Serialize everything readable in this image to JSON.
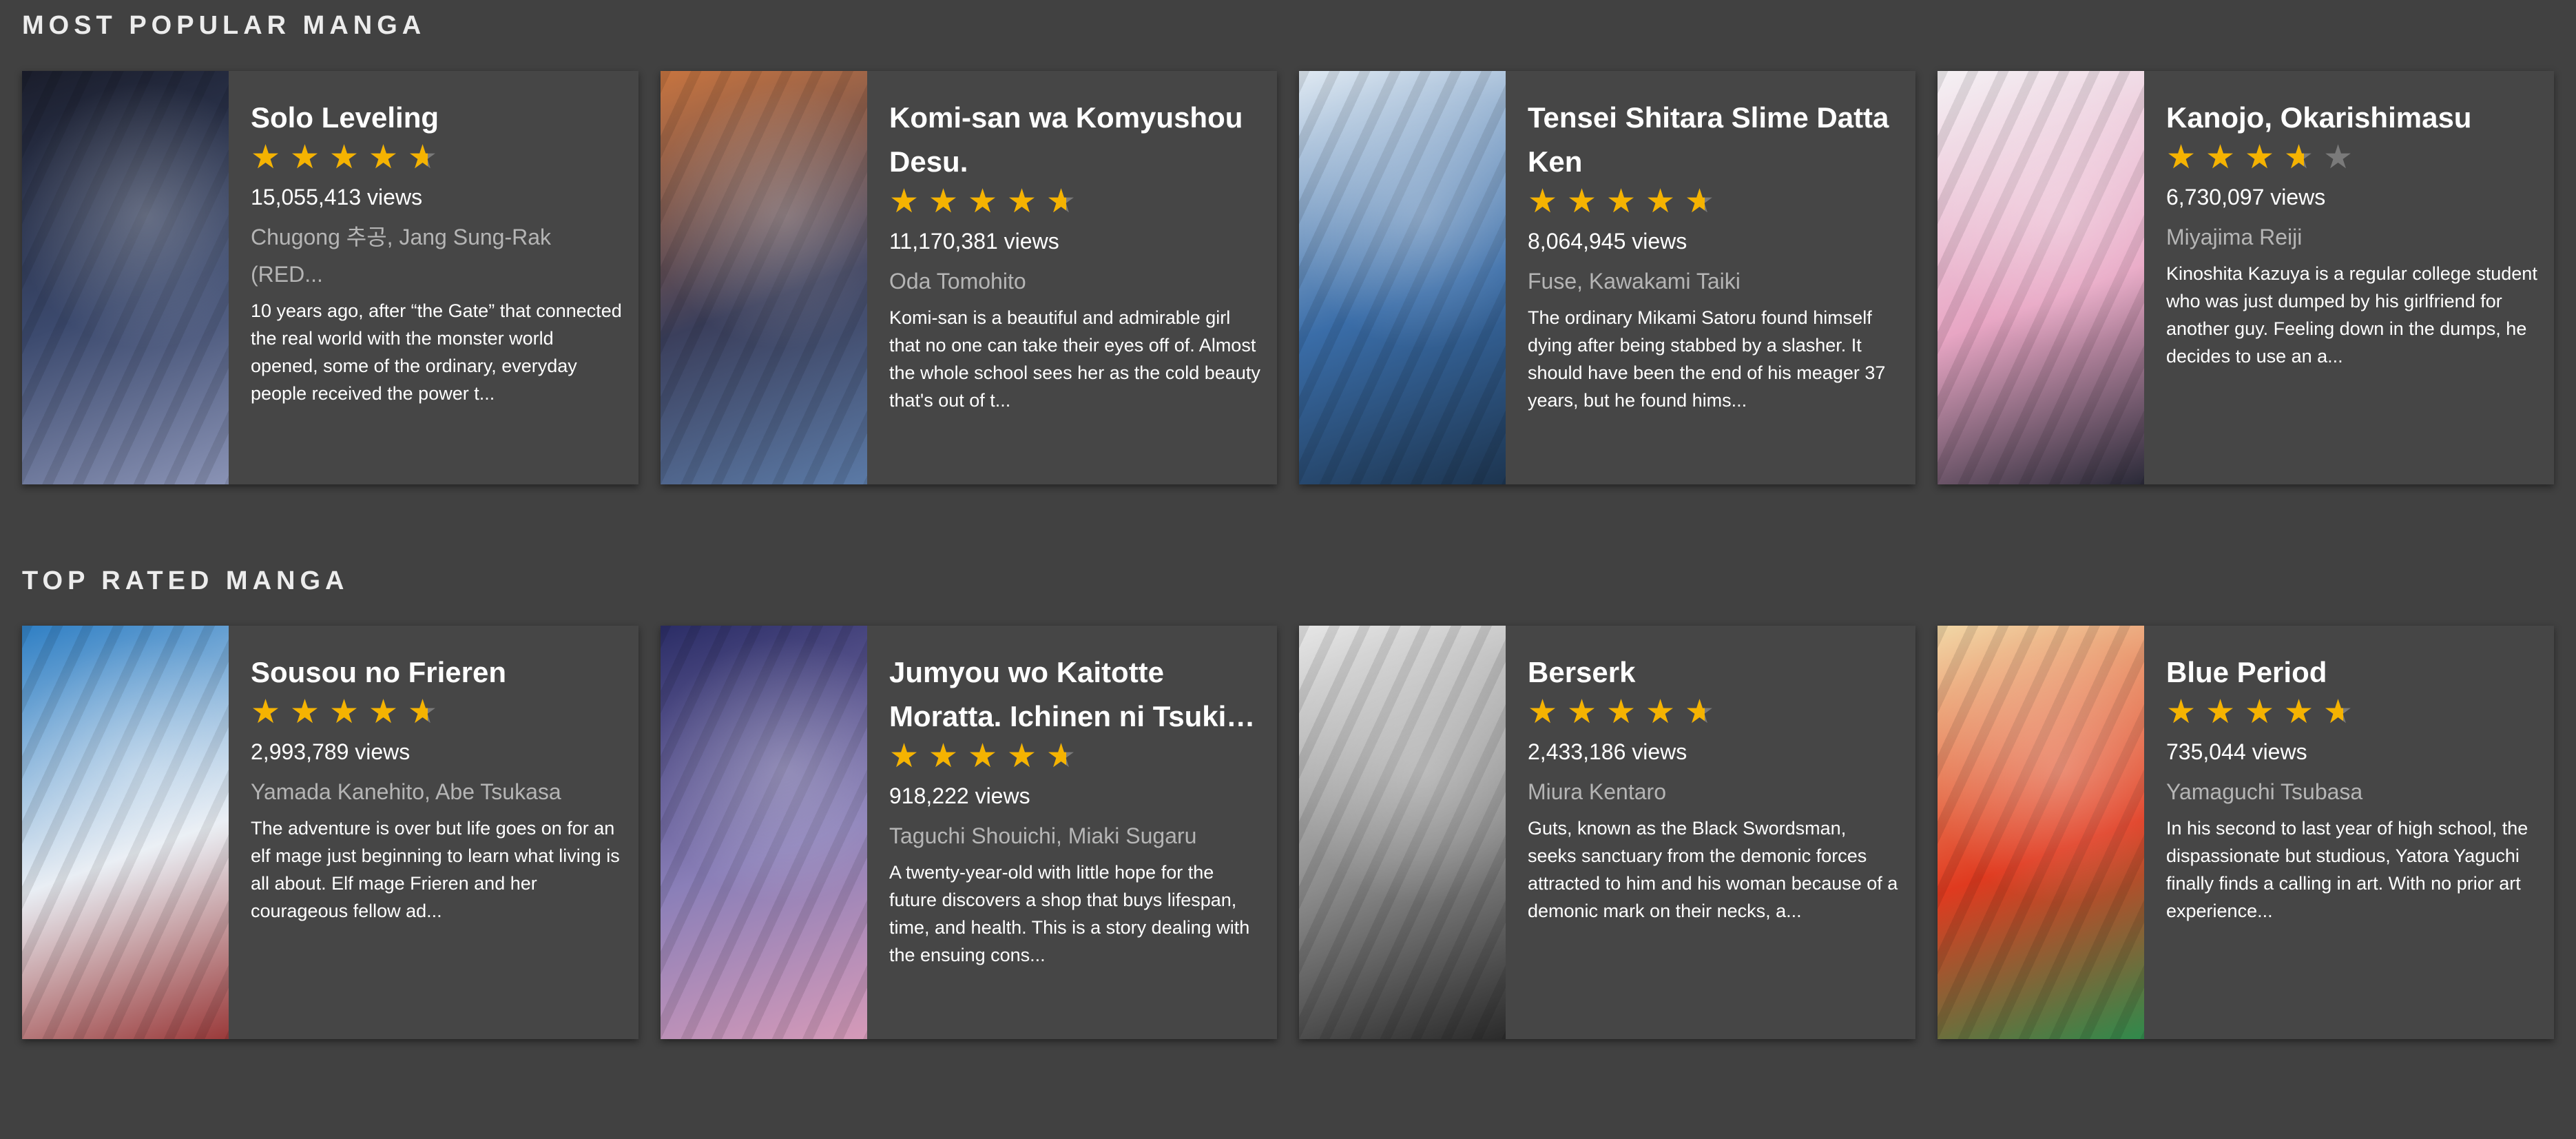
{
  "sections": [
    {
      "title": "MOST POPULAR MANGA",
      "cards": [
        {
          "title": "Solo Leveling",
          "rating": 4.5,
          "views": "15,055,413 views",
          "authors": "Chugong 추공, Jang Sung-Rak (RED...",
          "description": "10 years ago, after “the Gate” that connected the real world with the monster world opened, some of the ordinary, everyday people received the power t...",
          "cover_colors": [
            "#1a1d2b",
            "#3c4a6e",
            "#8a93b5"
          ]
        },
        {
          "title": "Komi-san wa Komyushou Desu.",
          "rating": 4.5,
          "views": "11,170,381 views",
          "authors": "Oda Tomohito",
          "description": "Komi-san is a beautiful and admirable girl that no one can take their eyes off of. Almost the whole school sees her as the cold beauty that's out of t...",
          "cover_colors": [
            "#c7743f",
            "#3b3f5c",
            "#5b7aa6"
          ]
        },
        {
          "title": "Tensei Shitara Slime Datta Ken",
          "rating": 4.5,
          "views": "8,064,945 views",
          "authors": "Fuse, Kawakami Taiki",
          "description": "The ordinary Mikami Satoru found himself dying after being stabbed by a slasher. It should have been the end of his meager 37 years, but he found hims...",
          "cover_colors": [
            "#dfe9f2",
            "#3a6da8",
            "#1d3550"
          ]
        },
        {
          "title": "Kanojo, Okarishimasu",
          "rating": 3.5,
          "views": "6,730,097 views",
          "authors": "Miyajima Reiji",
          "description": "Kinoshita Kazuya is a regular college student who was just dumped by his girlfriend for another guy. Feeling down in the dumps, he decides to use an a...",
          "cover_colors": [
            "#f4f1f4",
            "#e8a6c4",
            "#2a2a38"
          ]
        }
      ]
    },
    {
      "title": "TOP RATED MANGA",
      "cards": [
        {
          "title": "Sousou no Frieren",
          "rating": 4.5,
          "views": "2,993,789 views",
          "authors": "Yamada Kanehito, Abe Tsukasa",
          "description": "The adventure is over but life goes on for an elf mage just beginning to learn what living is all about. Elf mage Frieren and her courageous fellow ad...",
          "cover_colors": [
            "#2f7fc4",
            "#e9eef4",
            "#9a3a3a"
          ]
        },
        {
          "title": "Jumyou wo Kaitotte Moratta. Ichinen ni Tsuki, Ichi...",
          "rating": 4.5,
          "views": "918,222 views",
          "authors": "Taguchi Shouichi, Miaki Sugaru",
          "description": "A twenty-year-old with little hope for the future discovers a shop that buys lifespan, time, and health. This is a story dealing with the ensuing cons...",
          "cover_colors": [
            "#2b2d66",
            "#8a7fb8",
            "#d69ab8"
          ]
        },
        {
          "title": "Berserk",
          "rating": 4.5,
          "views": "2,433,186 views",
          "authors": "Miura Kentaro",
          "description": "Guts, known as the Black Swordsman, seeks sanctuary from the demonic forces attracted to him and his woman because of a demonic mark on their necks, a...",
          "cover_colors": [
            "#e6e6e6",
            "#8c8c8c",
            "#2b2b2b"
          ]
        },
        {
          "title": "Blue Period",
          "rating": 4.5,
          "views": "735,044 views",
          "authors": "Yamaguchi Tsubasa",
          "description": "In his second to last year of high school, the dispassionate but studious, Yatora Yaguchi finally finds a calling in art. With no prior art experience...",
          "cover_colors": [
            "#f1d7a6",
            "#e03a1f",
            "#2f8a4c"
          ]
        }
      ]
    }
  ]
}
